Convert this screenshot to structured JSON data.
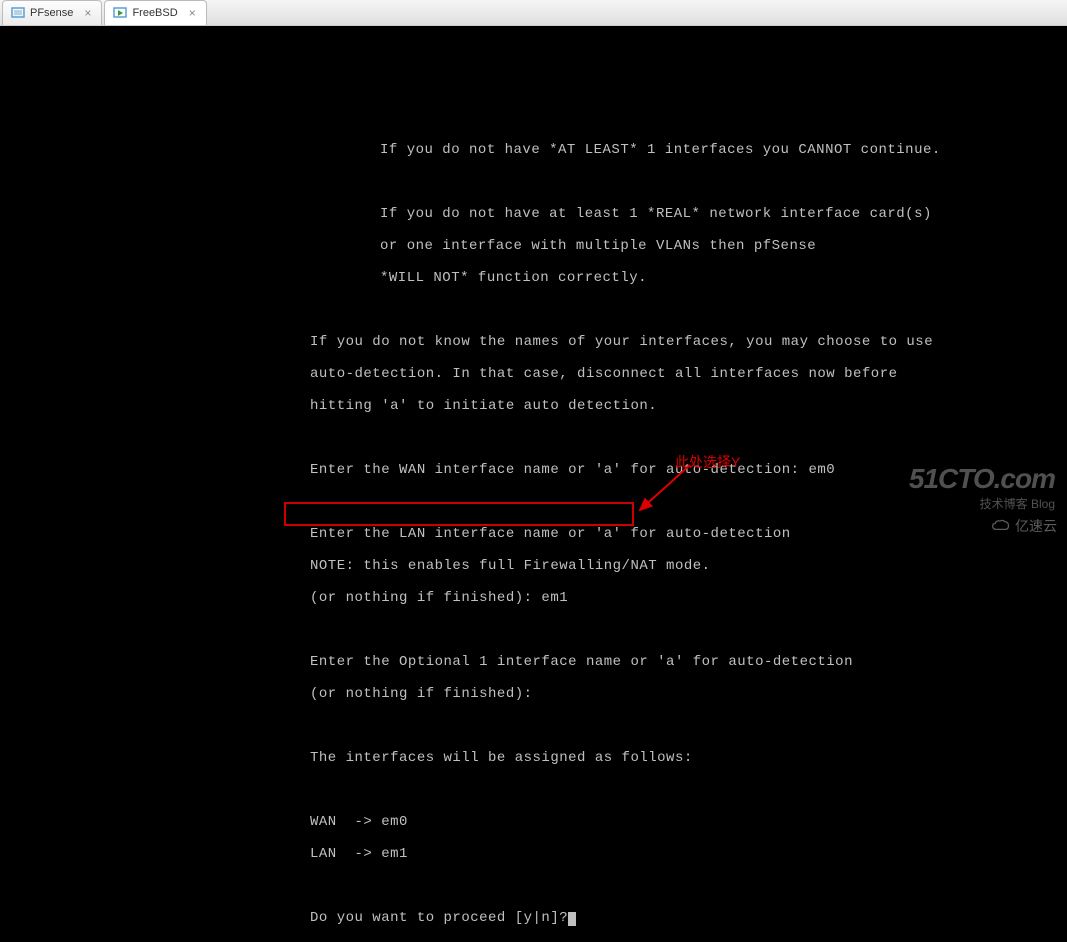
{
  "tabs": [
    {
      "label": "PFsense",
      "active": false
    },
    {
      "label": "FreeBSD",
      "active": true
    }
  ],
  "terminal": {
    "l1": "If you do not have *AT LEAST* 1 interfaces you CANNOT continue.",
    "l2": "If you do not have at least 1 *REAL* network interface card(s)",
    "l3": "or one interface with multiple VLANs then pfSense",
    "l4": "*WILL NOT* function correctly.",
    "l5": "If you do not know the names of your interfaces, you may choose to use",
    "l6": "auto-detection. In that case, disconnect all interfaces now before",
    "l7": "hitting 'a' to initiate auto detection.",
    "l8": "Enter the WAN interface name or 'a' for auto-detection: em0",
    "l9": "Enter the LAN interface name or 'a' for auto-detection",
    "l10": "NOTE: this enables full Firewalling/NAT mode.",
    "l11": "(or nothing if finished): em1",
    "l12": "Enter the Optional 1 interface name or 'a' for auto-detection",
    "l13": "(or nothing if finished):",
    "l14": "The interfaces will be assigned as follows:",
    "l15": "WAN  -> em0",
    "l16": "LAN  -> em1",
    "l17": "Do you want to proceed [y|n]?"
  },
  "annotation": {
    "note": "此处选择Y"
  },
  "watermark": {
    "main": "51CTO.com",
    "sub": "技术博客      Blog",
    "yisu": "亿速云"
  }
}
